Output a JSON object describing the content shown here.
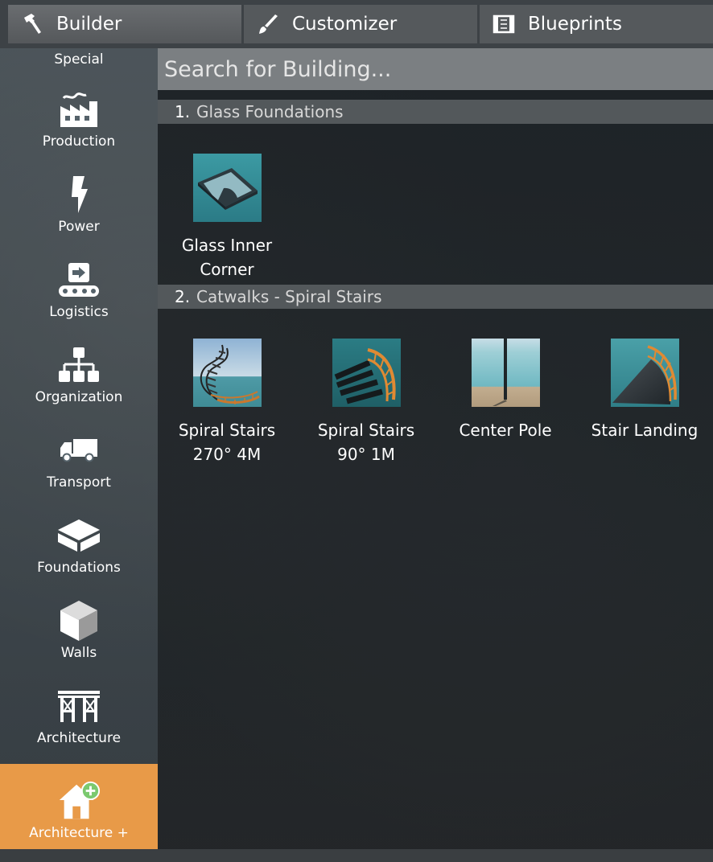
{
  "tabs": [
    {
      "label": "Builder",
      "icon": "hammer-icon",
      "active": true
    },
    {
      "label": "Customizer",
      "icon": "brush-icon",
      "active": false
    },
    {
      "label": "Blueprints",
      "icon": "blueprints-icon",
      "active": false
    }
  ],
  "sidebar": {
    "items": [
      {
        "label": "Special",
        "icon": "special-icon"
      },
      {
        "label": "Production",
        "icon": "factory-icon"
      },
      {
        "label": "Power",
        "icon": "lightning-icon"
      },
      {
        "label": "Logistics",
        "icon": "conveyor-icon"
      },
      {
        "label": "Organization",
        "icon": "hierarchy-icon"
      },
      {
        "label": "Transport",
        "icon": "truck-icon"
      },
      {
        "label": "Foundations",
        "icon": "foundation-icon"
      },
      {
        "label": "Walls",
        "icon": "wall-cube-icon"
      },
      {
        "label": "Architecture",
        "icon": "scaffold-icon"
      },
      {
        "label": "Architecture +",
        "icon": "house-plus-icon",
        "selected": true
      }
    ],
    "selected_color": "#e89a48"
  },
  "search": {
    "placeholder": "Search for Building..."
  },
  "categories": [
    {
      "number": "1.",
      "title": "Glass Foundations",
      "items": [
        {
          "label": "Glass Inner\nCorner"
        }
      ]
    },
    {
      "number": "2.",
      "title": "Catwalks - Spiral Stairs",
      "items": [
        {
          "label": "Spiral Stairs\n270° 4M"
        },
        {
          "label": "Spiral Stairs\n90° 1M"
        },
        {
          "label": "Center Pole"
        },
        {
          "label": "Stair Landing"
        }
      ]
    }
  ]
}
